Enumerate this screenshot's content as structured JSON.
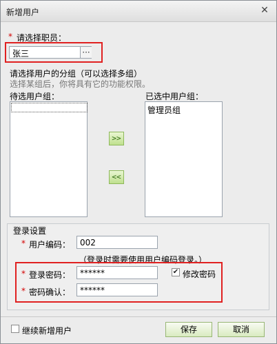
{
  "window": {
    "title": "新增用户",
    "close_glyph": "✕"
  },
  "employee": {
    "required_mark": "*",
    "label": "请选择职员：",
    "value": "张三",
    "picker_label": "···"
  },
  "groups": {
    "heading": "请选择用户的分组（可以选择多组）",
    "hint": "选择某组后，你将具有它的功能权限。",
    "available_label": "待选用户组：",
    "available_items": [],
    "selected_label": "已选中用户组：",
    "selected_items": [
      "管理员组"
    ],
    "add_label": ">>",
    "remove_label": "<<"
  },
  "login": {
    "section_title": "登录设置",
    "code_label": "用户编码：",
    "code_value": "002",
    "code_hint": "（登录时需要使用用户编码登录。）",
    "password_label": "登录密码：",
    "password_value": "******",
    "change_password_label": "修改密码",
    "change_password_checked": true,
    "check_glyph": "✔",
    "confirm_label": "密码确认：",
    "confirm_value": "******",
    "required_mark": "*"
  },
  "footer": {
    "continue_label": "继续新增用户",
    "continue_checked": false,
    "save_label": "保存",
    "cancel_label": "取消"
  },
  "colors": {
    "highlight": "#e02020",
    "required": "#d30000",
    "button_green": "#bfe08e"
  }
}
